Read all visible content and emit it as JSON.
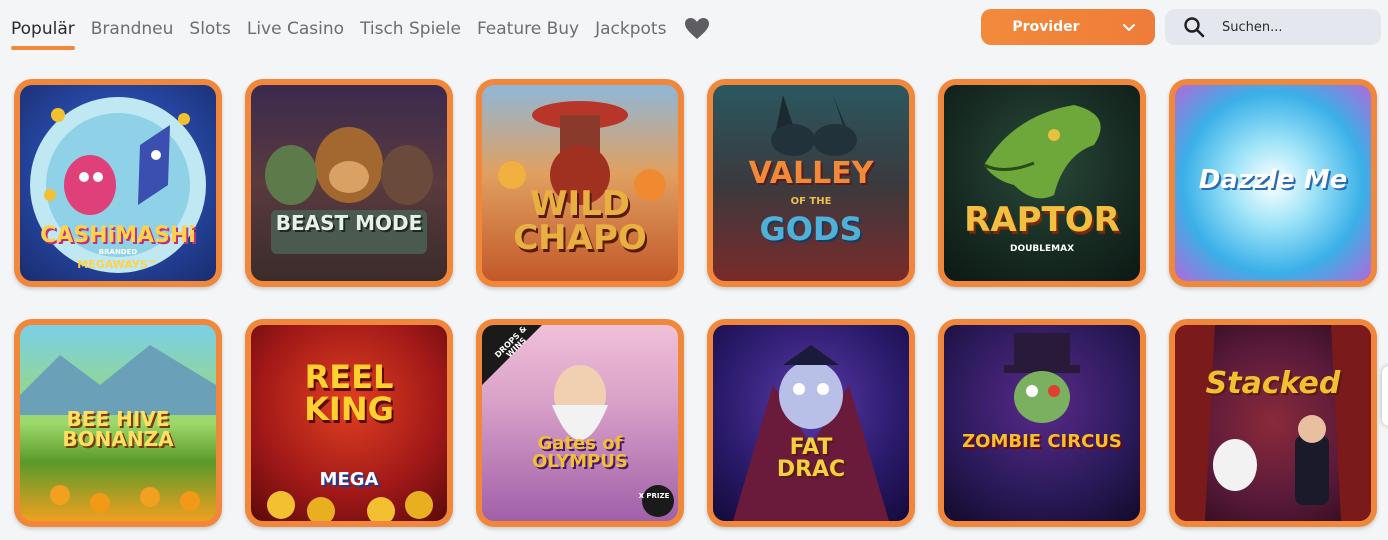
{
  "nav": {
    "tabs": [
      "Populär",
      "Brandneu",
      "Slots",
      "Live Casino",
      "Tisch Spiele",
      "Feature Buy",
      "Jackpots"
    ],
    "active_tab": "Populär",
    "favorites_icon": "heart-icon",
    "provider_label": "Provider",
    "search_placeholder": "Suchen..."
  },
  "colors": {
    "accent": "#f0873a",
    "search_bg": "#e4e8ee",
    "page_bg": "#f4f5f7"
  },
  "games": [
    {
      "title": "CASHiMASHi",
      "subtitle": "BRANDED",
      "badge": "MEGAWAYS™"
    },
    {
      "title": "BEAST MODE"
    },
    {
      "title": "WILD CHAPO"
    },
    {
      "title": "VALLEY",
      "subtitle": "OF THE",
      "badge": "GODS"
    },
    {
      "title": "RAPTOR",
      "badge": "DOUBLEMAX"
    },
    {
      "title": "Dazzle Me"
    },
    {
      "title": "BEE HIVE BONANZA"
    },
    {
      "title": "REEL KING",
      "badge": "MEGA"
    },
    {
      "title": "Gates of OLYMPUS",
      "subtitle": "DROPS & WINS",
      "badge": "X PRIZE"
    },
    {
      "title": "FAT DRAC"
    },
    {
      "title": "ZOMBIE CIRCUS"
    },
    {
      "title": "Stacked"
    }
  ]
}
